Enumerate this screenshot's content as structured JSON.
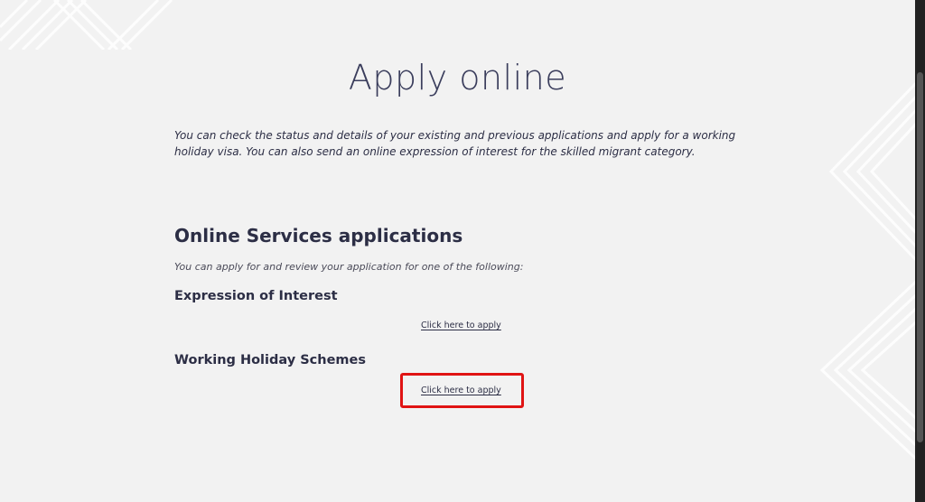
{
  "page": {
    "title": "Apply online",
    "intro": "You can check the status and details of your existing and previous applications and apply for a working holiday visa. You can also send an online expression of interest for the skilled migrant category."
  },
  "online_services": {
    "heading": "Online Services applications",
    "subtitle": "You can apply for and review your application for one of the following:",
    "items": [
      {
        "heading": "Expression of Interest",
        "link_label": "Click here to apply"
      },
      {
        "heading": "Working Holiday Schemes",
        "link_label": "Click here to apply"
      }
    ]
  },
  "colors": {
    "background": "#f2f2f2",
    "text": "#2c2e45",
    "highlight": "#e01414",
    "scrollbar": "#222222"
  },
  "icons": {
    "top_left_decoration": "diagonal-lines-pattern",
    "right_decoration": "chevron-lines-pattern"
  }
}
